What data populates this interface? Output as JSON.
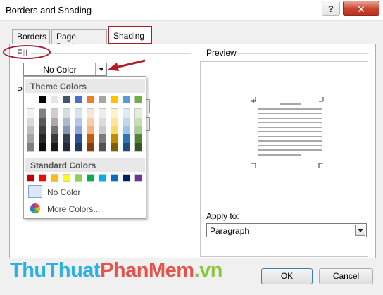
{
  "window": {
    "title": "Borders and Shading",
    "help_label": "?",
    "close_label": "✕"
  },
  "tabs": [
    {
      "label": "Borders",
      "active": false
    },
    {
      "label": "Page Border",
      "active": false
    },
    {
      "label": "Shading",
      "active": true
    }
  ],
  "fill": {
    "label": "Fill",
    "value": "No Color"
  },
  "pattern": {
    "label_partial": "Pa"
  },
  "color_popup": {
    "theme_header": "Theme Colors",
    "theme_top": [
      "#ffffff",
      "#000000",
      "#e7e6e6",
      "#44546a",
      "#4472c4",
      "#ed7d31",
      "#a5a5a5",
      "#ffc000",
      "#5b9bd5",
      "#70ad47"
    ],
    "theme_shades": [
      [
        "#f2f2f2",
        "#d9d9d9",
        "#bfbfbf",
        "#a6a6a6",
        "#808080"
      ],
      [
        "#808080",
        "#595959",
        "#404040",
        "#262626",
        "#0d0d0d"
      ],
      [
        "#d0cece",
        "#aeaaaa",
        "#757171",
        "#3a3838",
        "#171616"
      ],
      [
        "#d6dce4",
        "#adb9ca",
        "#8497b0",
        "#333f4f",
        "#222a35"
      ],
      [
        "#d9e2f3",
        "#b4c6e7",
        "#8eaadb",
        "#2f5496",
        "#1f3864"
      ],
      [
        "#fbe5d5",
        "#f7cbac",
        "#f4b183",
        "#c55a11",
        "#843c0b"
      ],
      [
        "#ededed",
        "#dbdbdb",
        "#c9c9c9",
        "#7b7b7b",
        "#525252"
      ],
      [
        "#fff2cc",
        "#fee599",
        "#ffd965",
        "#bf8f00",
        "#7f6000"
      ],
      [
        "#deebf6",
        "#bdd7ee",
        "#9dc3e6",
        "#2e75b5",
        "#1f4e79"
      ],
      [
        "#e2efd9",
        "#c5e0b3",
        "#a8d08d",
        "#538135",
        "#375623"
      ]
    ],
    "standard_header": "Standard Colors",
    "standard": [
      "#c00000",
      "#ff0000",
      "#ffc000",
      "#ffff00",
      "#92d050",
      "#00b050",
      "#00b0f0",
      "#0070c0",
      "#002060",
      "#7030a0"
    ],
    "no_color_label": "No Color",
    "more_colors_label": "More Colors..."
  },
  "preview": {
    "label": "Preview"
  },
  "apply_to": {
    "label": "Apply to:",
    "value": "Paragraph"
  },
  "buttons": {
    "ok": "OK",
    "cancel": "Cancel"
  },
  "watermark": {
    "part1": "ThuThuat",
    "part2": "PhanMem",
    "part3": ".vn"
  }
}
